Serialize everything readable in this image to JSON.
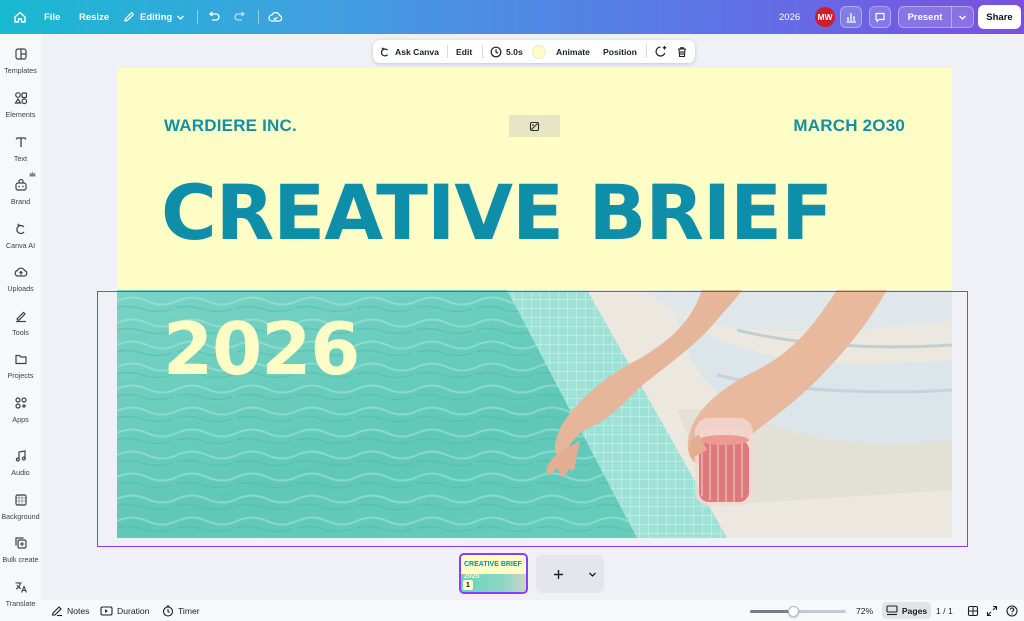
{
  "topbar": {
    "file": "File",
    "resize": "Resize",
    "editing": "Editing",
    "doc_title": "2026",
    "avatar_initials": "MW",
    "present": "Present",
    "share": "Share"
  },
  "sidebar": {
    "items": [
      {
        "label": "Templates",
        "icon": "templates-icon"
      },
      {
        "label": "Elements",
        "icon": "elements-icon"
      },
      {
        "label": "Text",
        "icon": "text-icon"
      },
      {
        "label": "Brand",
        "icon": "brand-icon"
      },
      {
        "label": "Canva AI",
        "icon": "canva-ai-icon"
      },
      {
        "label": "Uploads",
        "icon": "uploads-icon"
      },
      {
        "label": "Tools",
        "icon": "tools-icon"
      },
      {
        "label": "Projects",
        "icon": "projects-icon"
      },
      {
        "label": "Apps",
        "icon": "apps-icon"
      },
      {
        "label": "Audio",
        "icon": "audio-icon"
      },
      {
        "label": "Background",
        "icon": "background-icon"
      },
      {
        "label": "Bulk create",
        "icon": "bulk-create-icon"
      },
      {
        "label": "Translate",
        "icon": "translate-icon"
      }
    ]
  },
  "context_toolbar": {
    "ask_canva": "Ask Canva",
    "edit": "Edit",
    "duration": "5.0s",
    "animate": "Animate",
    "position": "Position",
    "color_swatch": "#fffdc6"
  },
  "slide": {
    "company": "WARDIERE INC.",
    "date": "MARCH 2O30",
    "title": "CREATIVE BRIEF",
    "year": "2026",
    "colors": {
      "background": "#fffdc6",
      "accent": "#0f8ea9"
    }
  },
  "thumbnail": {
    "title": "CREATIVE BRIEF",
    "year": "2026",
    "page_number": "1"
  },
  "bottombar": {
    "notes": "Notes",
    "duration": "Duration",
    "timer": "Timer",
    "zoom": "72%",
    "zoom_fraction": 0.72,
    "pages": "Pages",
    "page_count": "1 / 1"
  },
  "colors": {
    "selection": "#8b3dff",
    "avatar": "#d11c2a"
  }
}
